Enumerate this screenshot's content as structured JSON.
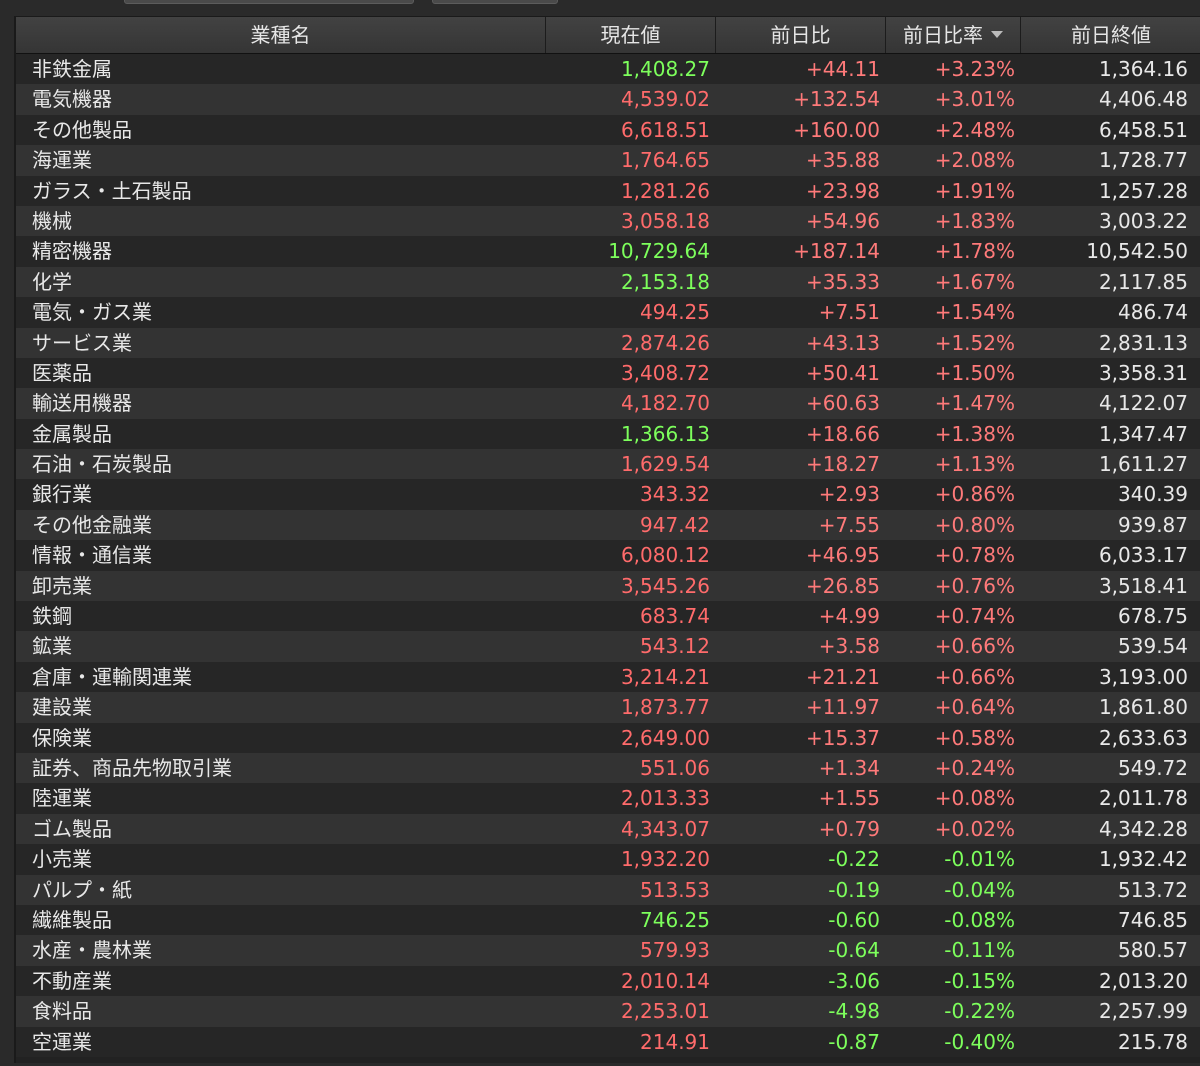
{
  "header": {
    "name": "業種名",
    "current": "現在値",
    "diff": "前日比",
    "rate": "前日比率",
    "prev_close": "前日終値"
  },
  "colors": {
    "up": "#ff6b6b",
    "down": "#7dff5c",
    "neutral": "#e8e8e8"
  },
  "rows": [
    {
      "name": "非鉄金属",
      "current": "1,408.27",
      "cur_color": "green",
      "diff": "+44.11",
      "rate": "+3.23%",
      "prev": "1,364.16"
    },
    {
      "name": "電気機器",
      "current": "4,539.02",
      "cur_color": "red",
      "diff": "+132.54",
      "rate": "+3.01%",
      "prev": "4,406.48"
    },
    {
      "name": "その他製品",
      "current": "6,618.51",
      "cur_color": "red",
      "diff": "+160.00",
      "rate": "+2.48%",
      "prev": "6,458.51"
    },
    {
      "name": "海運業",
      "current": "1,764.65",
      "cur_color": "red",
      "diff": "+35.88",
      "rate": "+2.08%",
      "prev": "1,728.77"
    },
    {
      "name": "ガラス・土石製品",
      "current": "1,281.26",
      "cur_color": "red",
      "diff": "+23.98",
      "rate": "+1.91%",
      "prev": "1,257.28"
    },
    {
      "name": "機械",
      "current": "3,058.18",
      "cur_color": "red",
      "diff": "+54.96",
      "rate": "+1.83%",
      "prev": "3,003.22"
    },
    {
      "name": "精密機器",
      "current": "10,729.64",
      "cur_color": "green",
      "diff": "+187.14",
      "rate": "+1.78%",
      "prev": "10,542.50"
    },
    {
      "name": "化学",
      "current": "2,153.18",
      "cur_color": "green",
      "diff": "+35.33",
      "rate": "+1.67%",
      "prev": "2,117.85"
    },
    {
      "name": "電気・ガス業",
      "current": "494.25",
      "cur_color": "red",
      "diff": "+7.51",
      "rate": "+1.54%",
      "prev": "486.74"
    },
    {
      "name": "サービス業",
      "current": "2,874.26",
      "cur_color": "red",
      "diff": "+43.13",
      "rate": "+1.52%",
      "prev": "2,831.13"
    },
    {
      "name": "医薬品",
      "current": "3,408.72",
      "cur_color": "red",
      "diff": "+50.41",
      "rate": "+1.50%",
      "prev": "3,358.31"
    },
    {
      "name": "輸送用機器",
      "current": "4,182.70",
      "cur_color": "red",
      "diff": "+60.63",
      "rate": "+1.47%",
      "prev": "4,122.07"
    },
    {
      "name": "金属製品",
      "current": "1,366.13",
      "cur_color": "green",
      "diff": "+18.66",
      "rate": "+1.38%",
      "prev": "1,347.47"
    },
    {
      "name": "石油・石炭製品",
      "current": "1,629.54",
      "cur_color": "red",
      "diff": "+18.27",
      "rate": "+1.13%",
      "prev": "1,611.27"
    },
    {
      "name": "銀行業",
      "current": "343.32",
      "cur_color": "red",
      "diff": "+2.93",
      "rate": "+0.86%",
      "prev": "340.39"
    },
    {
      "name": "その他金融業",
      "current": "947.42",
      "cur_color": "red",
      "diff": "+7.55",
      "rate": "+0.80%",
      "prev": "939.87"
    },
    {
      "name": "情報・通信業",
      "current": "6,080.12",
      "cur_color": "red",
      "diff": "+46.95",
      "rate": "+0.78%",
      "prev": "6,033.17"
    },
    {
      "name": "卸売業",
      "current": "3,545.26",
      "cur_color": "red",
      "diff": "+26.85",
      "rate": "+0.76%",
      "prev": "3,518.41"
    },
    {
      "name": "鉄鋼",
      "current": "683.74",
      "cur_color": "red",
      "diff": "+4.99",
      "rate": "+0.74%",
      "prev": "678.75"
    },
    {
      "name": "鉱業",
      "current": "543.12",
      "cur_color": "red",
      "diff": "+3.58",
      "rate": "+0.66%",
      "prev": "539.54"
    },
    {
      "name": "倉庫・運輸関連業",
      "current": "3,214.21",
      "cur_color": "red",
      "diff": "+21.21",
      "rate": "+0.66%",
      "prev": "3,193.00"
    },
    {
      "name": "建設業",
      "current": "1,873.77",
      "cur_color": "red",
      "diff": "+11.97",
      "rate": "+0.64%",
      "prev": "1,861.80"
    },
    {
      "name": "保険業",
      "current": "2,649.00",
      "cur_color": "red",
      "diff": "+15.37",
      "rate": "+0.58%",
      "prev": "2,633.63"
    },
    {
      "name": "証券、商品先物取引業",
      "current": "551.06",
      "cur_color": "red",
      "diff": "+1.34",
      "rate": "+0.24%",
      "prev": "549.72"
    },
    {
      "name": "陸運業",
      "current": "2,013.33",
      "cur_color": "red",
      "diff": "+1.55",
      "rate": "+0.08%",
      "prev": "2,011.78"
    },
    {
      "name": "ゴム製品",
      "current": "4,343.07",
      "cur_color": "red",
      "diff": "+0.79",
      "rate": "+0.02%",
      "prev": "4,342.28"
    },
    {
      "name": "小売業",
      "current": "1,932.20",
      "cur_color": "red",
      "diff": "-0.22",
      "rate": "-0.01%",
      "prev": "1,932.42"
    },
    {
      "name": "パルプ・紙",
      "current": "513.53",
      "cur_color": "red",
      "diff": "-0.19",
      "rate": "-0.04%",
      "prev": "513.72"
    },
    {
      "name": "繊維製品",
      "current": "746.25",
      "cur_color": "green",
      "diff": "-0.60",
      "rate": "-0.08%",
      "prev": "746.85"
    },
    {
      "name": "水産・農林業",
      "current": "579.93",
      "cur_color": "red",
      "diff": "-0.64",
      "rate": "-0.11%",
      "prev": "580.57"
    },
    {
      "name": "不動産業",
      "current": "2,010.14",
      "cur_color": "red",
      "diff": "-3.06",
      "rate": "-0.15%",
      "prev": "2,013.20"
    },
    {
      "name": "食料品",
      "current": "2,253.01",
      "cur_color": "red",
      "diff": "-4.98",
      "rate": "-0.22%",
      "prev": "2,257.99"
    },
    {
      "name": "空運業",
      "current": "214.91",
      "cur_color": "red",
      "diff": "-0.87",
      "rate": "-0.40%",
      "prev": "215.78"
    }
  ]
}
